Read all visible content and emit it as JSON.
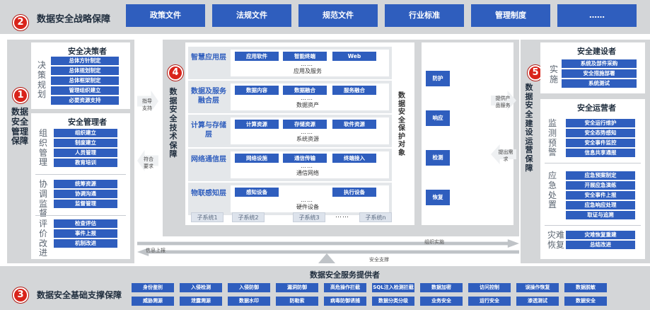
{
  "strategy": {
    "num": "2",
    "title": "数据安全战略保障",
    "items": [
      "政策文件",
      "法规文件",
      "规范文件",
      "行业标准",
      "管理制度",
      "……"
    ]
  },
  "mgmt": {
    "num": "1",
    "title": "数据安全管理保障",
    "decision": {
      "title": "安全决策者",
      "cat": "决策规划",
      "items": [
        "总体方针制定",
        "总体规划制定",
        "总体框架制定",
        "管理组织建立",
        "必要资源支持"
      ]
    },
    "manager": {
      "title": "安全管理者",
      "groups": [
        {
          "cat": "组织管理",
          "items": [
            "组织建立",
            "制度建立",
            "人员管理",
            "教育培训"
          ]
        },
        {
          "cat": "协调监督",
          "items": [
            "统筹资源",
            "协调沟通",
            "监督管理"
          ]
        },
        {
          "cat": "评价改进",
          "items": [
            "检查评估",
            "事件上报",
            "机制改进"
          ]
        }
      ]
    }
  },
  "tech": {
    "num": "4",
    "title": "数据安全技术保障",
    "layers": [
      {
        "label": "智慧应用层",
        "items": [
          "应用软件",
          "智能终端",
          "Web"
        ],
        "dots": "……",
        "sub": "应用及服务"
      },
      {
        "label": "数据及服务融合层",
        "items": [
          "数据内容",
          "数据融合",
          "服务融合"
        ],
        "dots": "……",
        "sub": "数据资产"
      },
      {
        "label": "计算与存储层",
        "items": [
          "计算资源",
          "存储资源",
          "软件资源"
        ],
        "dots": "……",
        "sub": "系统资源"
      },
      {
        "label": "网络通信层",
        "items": [
          "网络设施",
          "通信传输",
          "终端接入"
        ],
        "dots": "……",
        "sub": "通信网络"
      },
      {
        "label": "物联感知层",
        "items": [
          "感知设备",
          "执行设备"
        ],
        "dots": "……",
        "sub": "硬件设备"
      }
    ],
    "subsystems": [
      "子系统1",
      "子系统2",
      "子系统3",
      "……",
      "子系统n"
    ],
    "protect_title": "数据安全保护对象",
    "actions": [
      "防护",
      "响应",
      "检测",
      "恢复"
    ]
  },
  "arrows": {
    "guide": "指导支持",
    "comply": "符合要求",
    "provide": "提供产品服务",
    "request": "提出需求",
    "org": "组织实施",
    "report": "信息上报",
    "support": "安全支撑"
  },
  "build": {
    "num": "5",
    "title": "数据安全建设运营保障",
    "builder": {
      "title": "安全建设者",
      "cat": "实施",
      "items": [
        "系统及部件采购",
        "安全措施部署",
        "系统测试"
      ]
    },
    "operator": {
      "title": "安全运营者",
      "groups": [
        {
          "cat": "监测预警",
          "items": [
            "安全运行维护",
            "安全态势感知",
            "安全事件监控",
            "信息共享通报"
          ]
        },
        {
          "cat": "应急处置",
          "items": [
            "应急预案制定",
            "开展应急演练",
            "安全事件上报",
            "应急响应处理",
            "取证与追溯"
          ]
        },
        {
          "cat": "灾难恢复",
          "items": [
            "灾难恢复重建",
            "总结改进"
          ]
        }
      ]
    }
  },
  "base": {
    "num": "3",
    "title": "数据安全基础支撑保障",
    "provider": "数据安全服务提供者",
    "row1": [
      "身份鉴别",
      "入侵检测",
      "入侵防御",
      "漏洞防御",
      "高危操作拦截",
      "SQL注入检测拦截",
      "数据加密",
      "访问控制",
      "误操作恢复",
      "数据脱敏"
    ],
    "row2": [
      "威胁溯源",
      "泄露溯源",
      "数据水印",
      "防勒索",
      "病毒防御诱捕",
      "数据分类分级",
      "业务安全",
      "运行安全",
      "渗透测试",
      "数据安全"
    ]
  },
  "colors": {
    "accent": "#2f5ebe",
    "badge": "#d9241b",
    "panel": "#d4d6d8"
  }
}
